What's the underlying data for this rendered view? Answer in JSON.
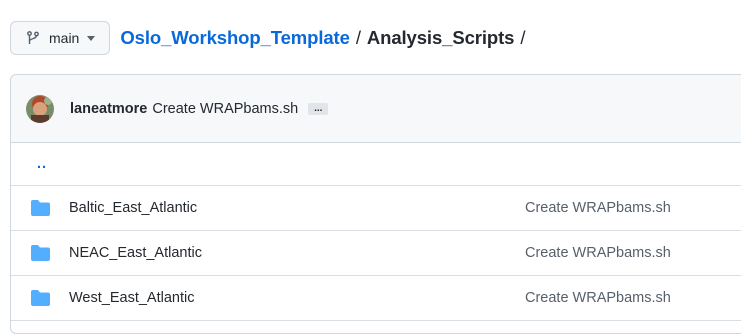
{
  "branch": {
    "label": "main",
    "icon": "git-branch-icon"
  },
  "breadcrumb": {
    "repo": "Oslo_Workshop_Template",
    "separator_1": "/",
    "directory": "Analysis_Scripts",
    "separator_2": "/"
  },
  "latest_commit": {
    "author": "laneatmore",
    "message": "Create WRAPbams.sh",
    "ellipsis": "..."
  },
  "parent_dir": {
    "label": ".."
  },
  "files": [
    {
      "name": "Baltic_East_Atlantic",
      "type": "directory",
      "commit_message": "Create WRAPbams.sh"
    },
    {
      "name": "NEAC_East_Atlantic",
      "type": "directory",
      "commit_message": "Create WRAPbams.sh"
    },
    {
      "name": "West_East_Atlantic",
      "type": "directory",
      "commit_message": "Create WRAPbams.sh"
    }
  ],
  "colors": {
    "link": "#0969da",
    "folder": "#54aeff",
    "header_bg": "#f6f8fa",
    "border": "#d0d7de"
  }
}
